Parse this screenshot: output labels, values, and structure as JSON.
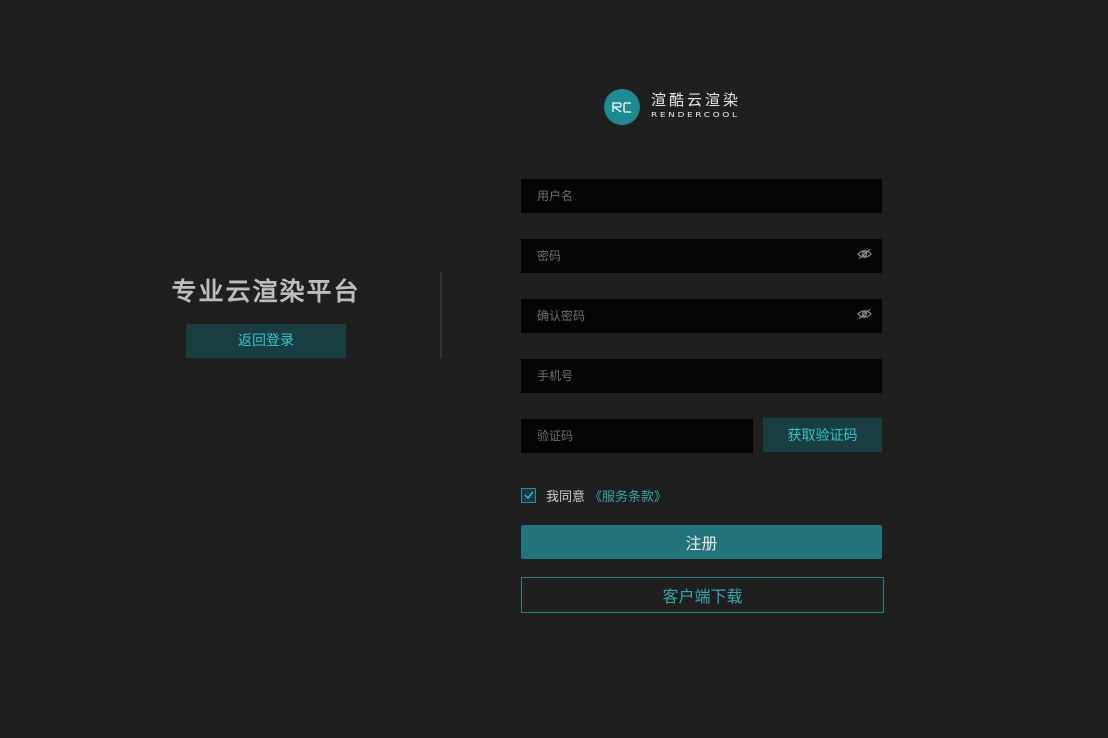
{
  "left": {
    "slogan": "专业云渲染平台",
    "back_login_label": "返回登录"
  },
  "logo": {
    "mark": "RC",
    "name_cn": "渲酷云渲染",
    "name_en": "RENDERCOOL",
    "color": "#1e8a92"
  },
  "form": {
    "username_placeholder": "用户名",
    "password_placeholder": "密码",
    "confirm_placeholder": "确认密码",
    "phone_placeholder": "手机号",
    "code_placeholder": "验证码",
    "get_code_label": "获取验证码",
    "agree_checked": true,
    "agree_text": "我同意",
    "terms_label": "《服务条款》",
    "register_label": "注册",
    "download_label": "客户端下载"
  },
  "icons": {
    "password_toggle": "eye-off-icon",
    "confirm_toggle": "eye-off-icon",
    "checkbox": "checkmark-icon"
  },
  "colors": {
    "background": "#1f1f1f",
    "accent": "#3cc2c8",
    "primary_button": "#1f757a",
    "secondary_button_bg": "#183e42"
  }
}
